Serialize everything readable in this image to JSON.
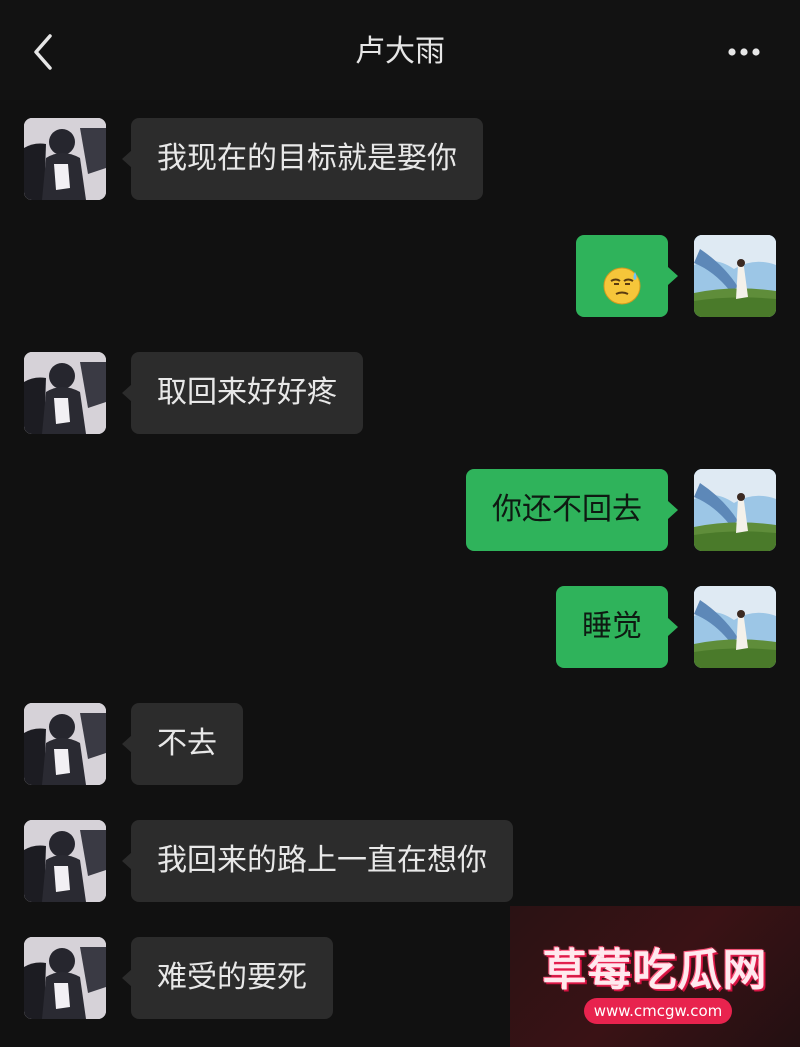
{
  "header": {
    "title": "卢大雨",
    "back_icon": "chevron-left-icon",
    "more_icon": "more-dots-icon"
  },
  "messages": [
    {
      "side": "in",
      "text": "我现在的目标就是娶你"
    },
    {
      "side": "out",
      "text": "",
      "emoji": "sweat-smile-emoji"
    },
    {
      "side": "in",
      "text": "取回来好好疼"
    },
    {
      "side": "out",
      "text": "你还不回去"
    },
    {
      "side": "out",
      "text": "睡觉"
    },
    {
      "side": "in",
      "text": "不去"
    },
    {
      "side": "in",
      "text": "我回来的路上一直在想你"
    },
    {
      "side": "in",
      "text": "难受的要死"
    }
  ],
  "watermark": {
    "title": "草莓吃瓜网",
    "url": "www.cmcgw.com"
  },
  "colors": {
    "background": "#111111",
    "incoming_bubble": "#2c2c2c",
    "outgoing_bubble": "#2fb35b",
    "watermark_accent": "#e8234e"
  }
}
